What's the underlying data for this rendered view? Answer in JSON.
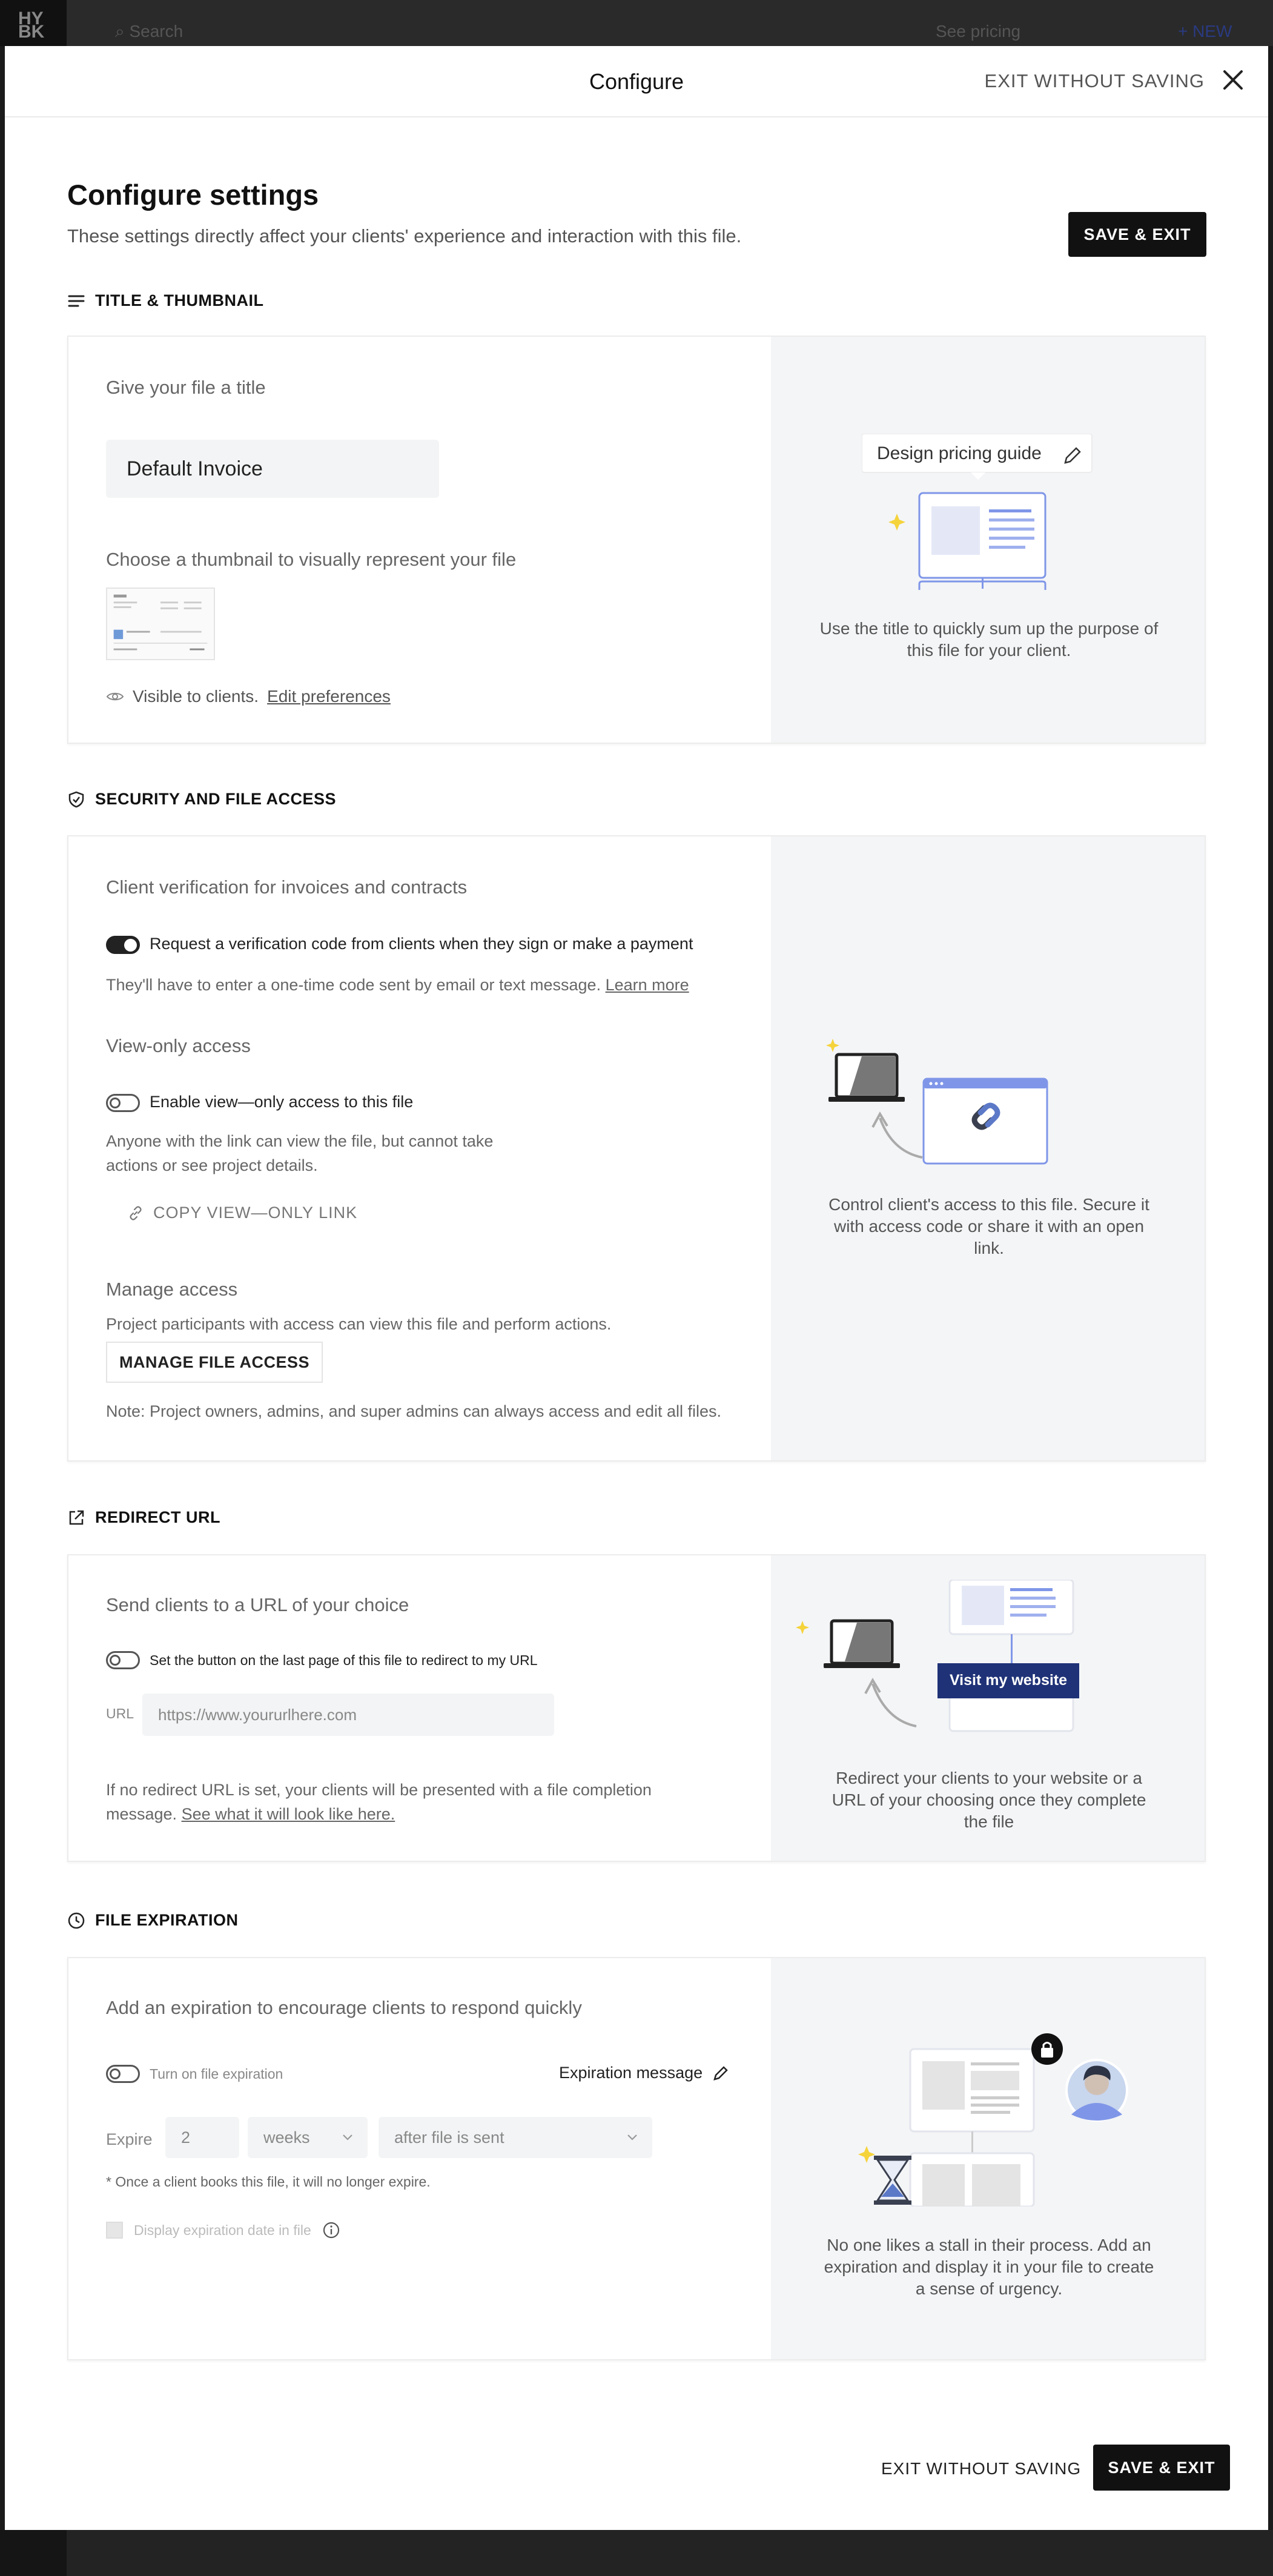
{
  "topbar": {
    "logo": "HY BK",
    "search": "Search",
    "pricing": "See pricing",
    "new_label": "+ NEW"
  },
  "modal": {
    "title": "Configure",
    "exit_label": "EXIT WITHOUT SAVING"
  },
  "page": {
    "heading": "Configure settings",
    "subtitle": "These settings directly affect your clients' experience and interaction with this file.",
    "save_exit": "SAVE & EXIT"
  },
  "title_section": {
    "header": "TITLE & THUMBNAIL",
    "give_title_label": "Give your file a title",
    "title_value": "Default Invoice",
    "thumb_label": "Choose a thumbnail to visually represent your file",
    "visible_text": "Visible to clients.",
    "edit_prefs": "Edit preferences",
    "ill_tooltip": "Design pricing guide",
    "ill_caption": "Use the title to quickly sum up the purpose of this file for your client."
  },
  "security_section": {
    "header": "SECURITY AND FILE ACCESS",
    "verify_label": "Client verification for invoices and contracts",
    "verify_toggle_label": "Request a verification code from clients when they sign or make a payment",
    "verify_help": "They'll have to enter a one-time code sent by email or text message.",
    "learn_more": "Learn more",
    "view_only_label": "View-only access",
    "view_only_toggle": "Enable view—only access to this file",
    "view_only_help_1": "Anyone with the link can view the file, but cannot take",
    "view_only_help_2": "actions or see project details.",
    "copy_link": "COPY VIEW—ONLY LINK",
    "manage_label": "Manage access",
    "manage_help": "Project participants with access can view this file and perform actions.",
    "manage_button": "MANAGE FILE ACCESS",
    "note": "Note: Project owners, admins, and super admins can always access and edit all files.",
    "ill_caption": "Control client's access to this file. Secure it with access code or share it with an open link."
  },
  "redirect_section": {
    "header": "REDIRECT URL",
    "send_label": "Send clients to a URL of your choice",
    "toggle_label": "Set the button on the last page of this file to redirect to my URL",
    "url_label": "URL",
    "url_placeholder": "https://www.yoururlhere.com",
    "help_1": "If no redirect URL is set, your clients will be presented with a file completion",
    "help_2": "message.",
    "see_link": "See what it will look like here.",
    "ill_button": "Visit my website",
    "ill_caption": "Redirect your clients to your website or a URL of your choosing once they complete the file"
  },
  "expiration_section": {
    "header": "FILE EXPIRATION",
    "add_label": "Add an expiration to encourage clients to respond quickly",
    "toggle_label": "Turn on file expiration",
    "exp_message": "Expiration message",
    "expire_label": "Expire",
    "expire_value": "2",
    "unit_value": "weeks",
    "after_value": "after file is sent",
    "note": "* Once a client books this file, it will no longer expire.",
    "display_date": "Display expiration date in file",
    "ill_caption": "No one likes a stall in their process. Add an expiration and display it in your file to create a sense of urgency."
  },
  "footer": {
    "exit_label": "EXIT WITHOUT SAVING",
    "save_label": "SAVE & EXIT"
  },
  "colors": {
    "accent_navy": "#1f3277",
    "sparkle": "#f5d33b",
    "illustration_blue": "#7f96e8"
  }
}
